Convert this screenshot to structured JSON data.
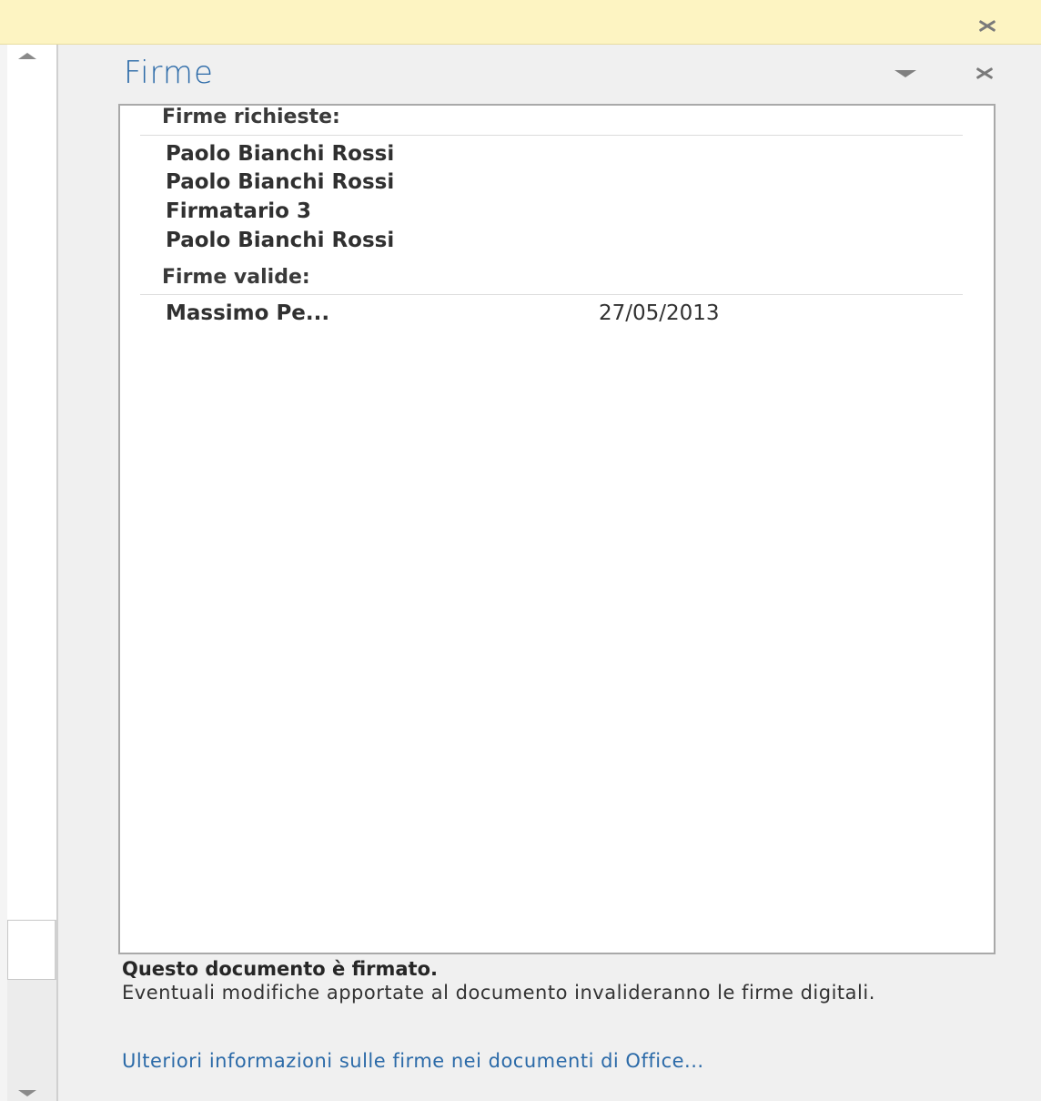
{
  "notification_bar": {
    "close_icon": "close-icon",
    "background_color": "#fdf4c2"
  },
  "scrollbar": {
    "up_icon": "arrow-up-icon",
    "down_icon": "arrow-down-icon"
  },
  "pane": {
    "title": "Firme",
    "title_color": "#2b6aa8",
    "menu_icon": "dropdown-arrow-icon",
    "close_icon": "close-icon"
  },
  "signatures": {
    "required_header": "Firme richieste:",
    "required": [
      {
        "name": "Paolo Bianchi Rossi"
      },
      {
        "name": "Paolo Bianchi Rossi"
      },
      {
        "name": "Firmatario 3"
      },
      {
        "name": "Paolo Bianchi Rossi"
      }
    ],
    "valid_header": "Firme valide:",
    "valid": [
      {
        "name": "Massimo Pe...",
        "date": "27/05/2013"
      }
    ]
  },
  "footer": {
    "status_title": "Questo documento è firmato.",
    "status_text": "Eventuali modifiche apportate al documento invalideranno le firme digitali.",
    "link_text": "Ulteriori informazioni sulle firme nei documenti di Office...",
    "link_color": "#2b6aa8"
  }
}
